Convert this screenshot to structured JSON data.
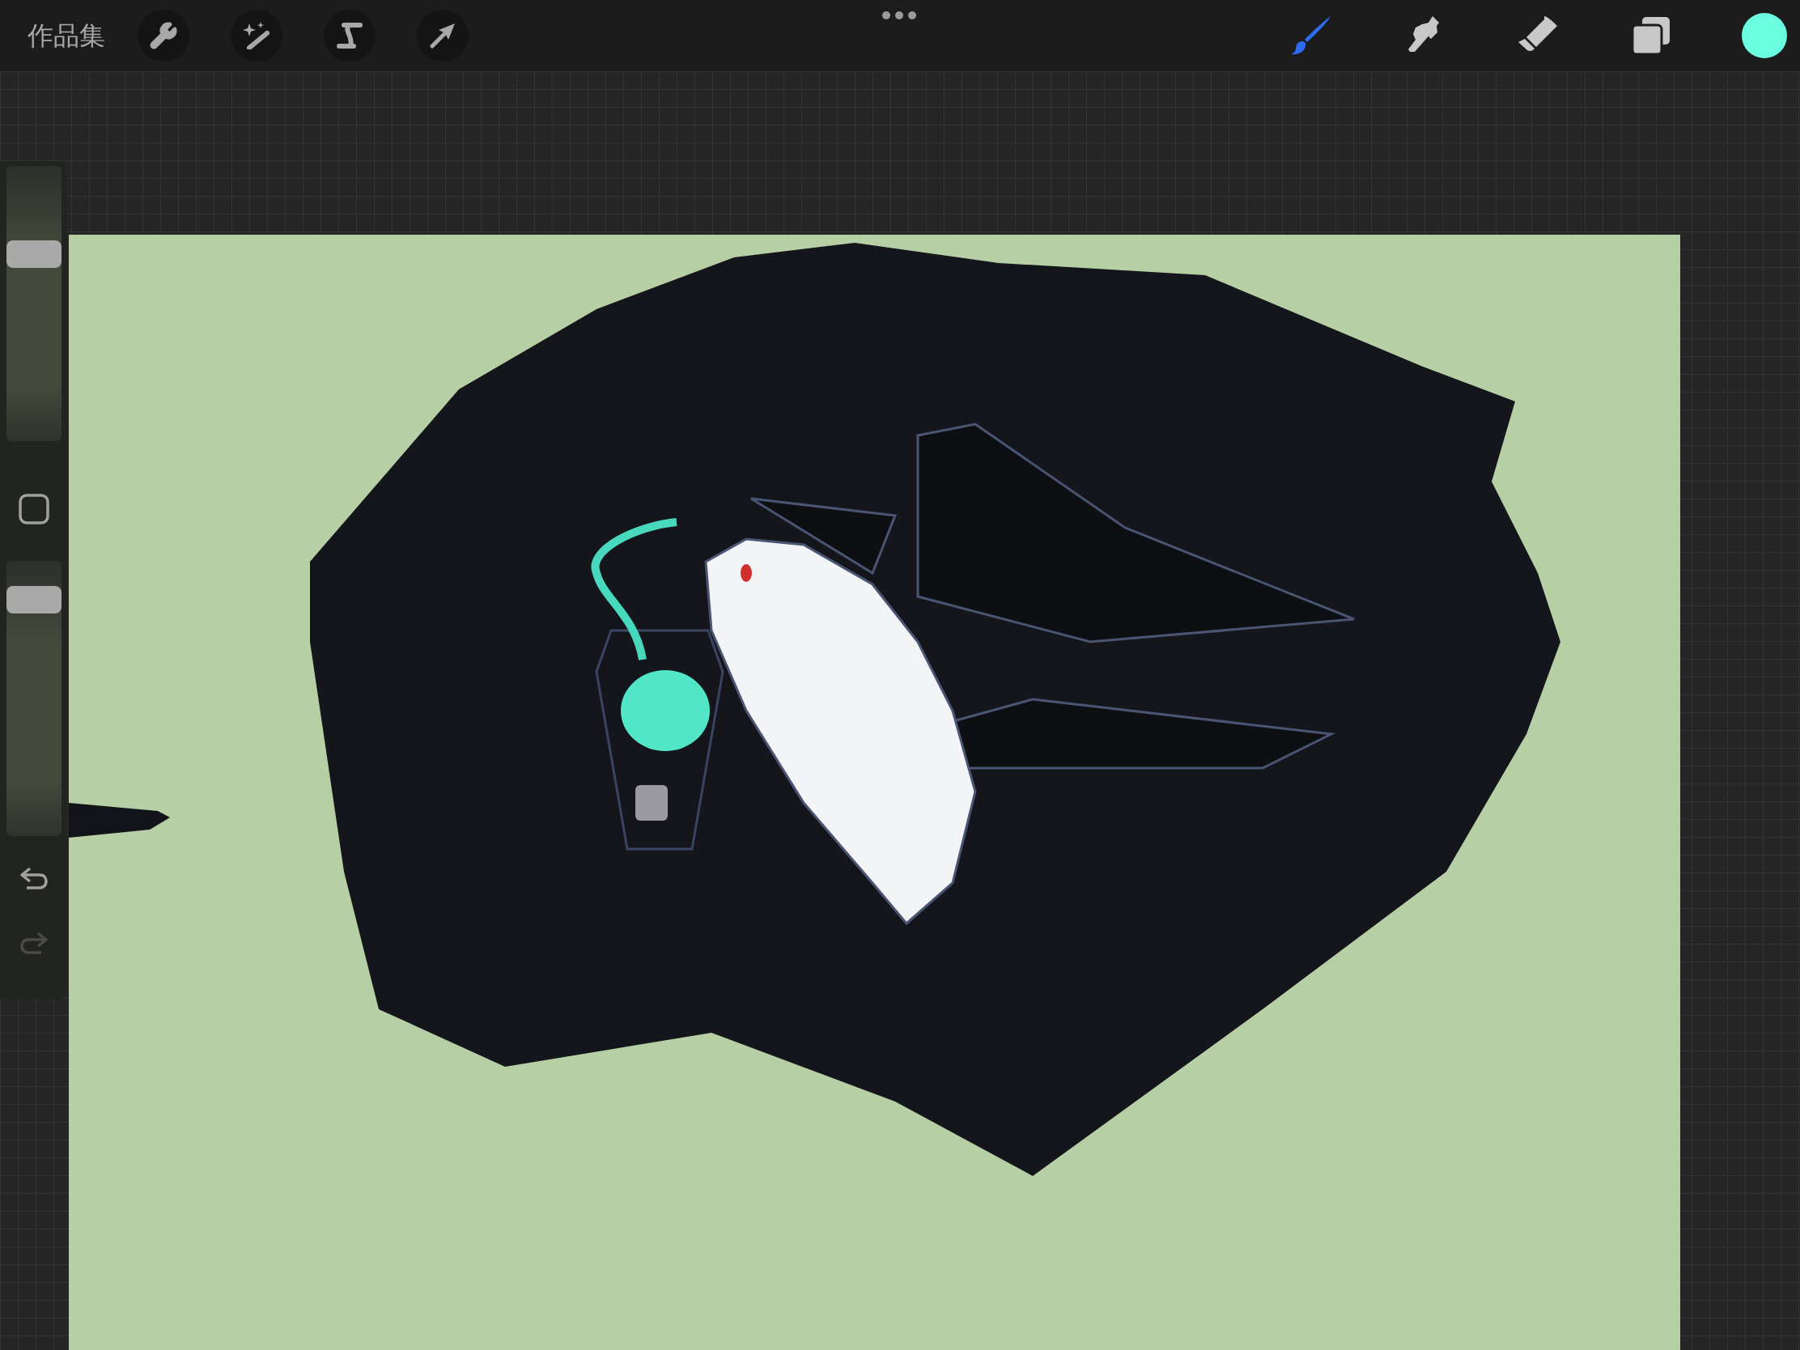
{
  "gallery_button": "作品集",
  "tools": [
    {
      "kind": "brush",
      "selected": true
    },
    {
      "kind": "smudge",
      "selected": false
    },
    {
      "kind": "eraser",
      "selected": false
    }
  ],
  "current_color": {
    "color": "#6bfde0"
  },
  "sidebar": {
    "size_slider": {
      "level": 0.7
    },
    "opacity_slider": {
      "level": 0.9
    },
    "undo": {
      "disabled": false
    },
    "redo": {
      "disabled": true
    }
  }
}
